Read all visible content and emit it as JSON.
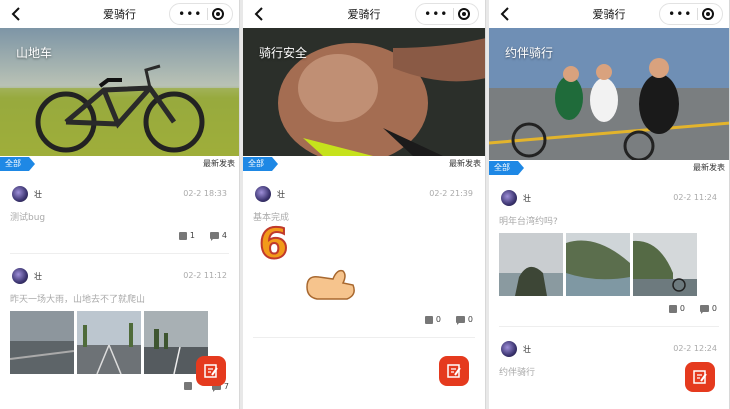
{
  "app": {
    "title": "爱骑行",
    "back_icon": "back-arrow-icon",
    "more_icon": "more-dots-icon",
    "close_icon": "target-icon",
    "all_tag": "全部",
    "sort_label": "最新发表",
    "accent": "#1e88e5",
    "fab_color": "#e53a1e"
  },
  "screens": [
    {
      "banner": {
        "label": "山地车"
      },
      "posts": [
        {
          "user": "壮",
          "time": "02-2 18:33",
          "text": "测试bug",
          "likes": "1",
          "comments": "4"
        },
        {
          "user": "壮",
          "time": "02-2 11:12",
          "text": "昨天一场大雨，山地去不了就爬山",
          "likes": "",
          "comments": "7"
        }
      ]
    },
    {
      "banner": {
        "label": "骑行安全"
      },
      "posts": [
        {
          "user": "壮",
          "time": "02-2 21:39",
          "text": "基本完成",
          "emoji_number": "6",
          "likes": "0",
          "comments": "0"
        }
      ]
    },
    {
      "banner": {
        "label": "约伴骑行"
      },
      "posts": [
        {
          "user": "壮",
          "time": "02-2 11:24",
          "text": "明年台湾约吗?",
          "likes": "0",
          "comments": "0"
        },
        {
          "user": "壮",
          "time": "02-2 12:24",
          "text": "约伴骑行"
        }
      ]
    }
  ]
}
